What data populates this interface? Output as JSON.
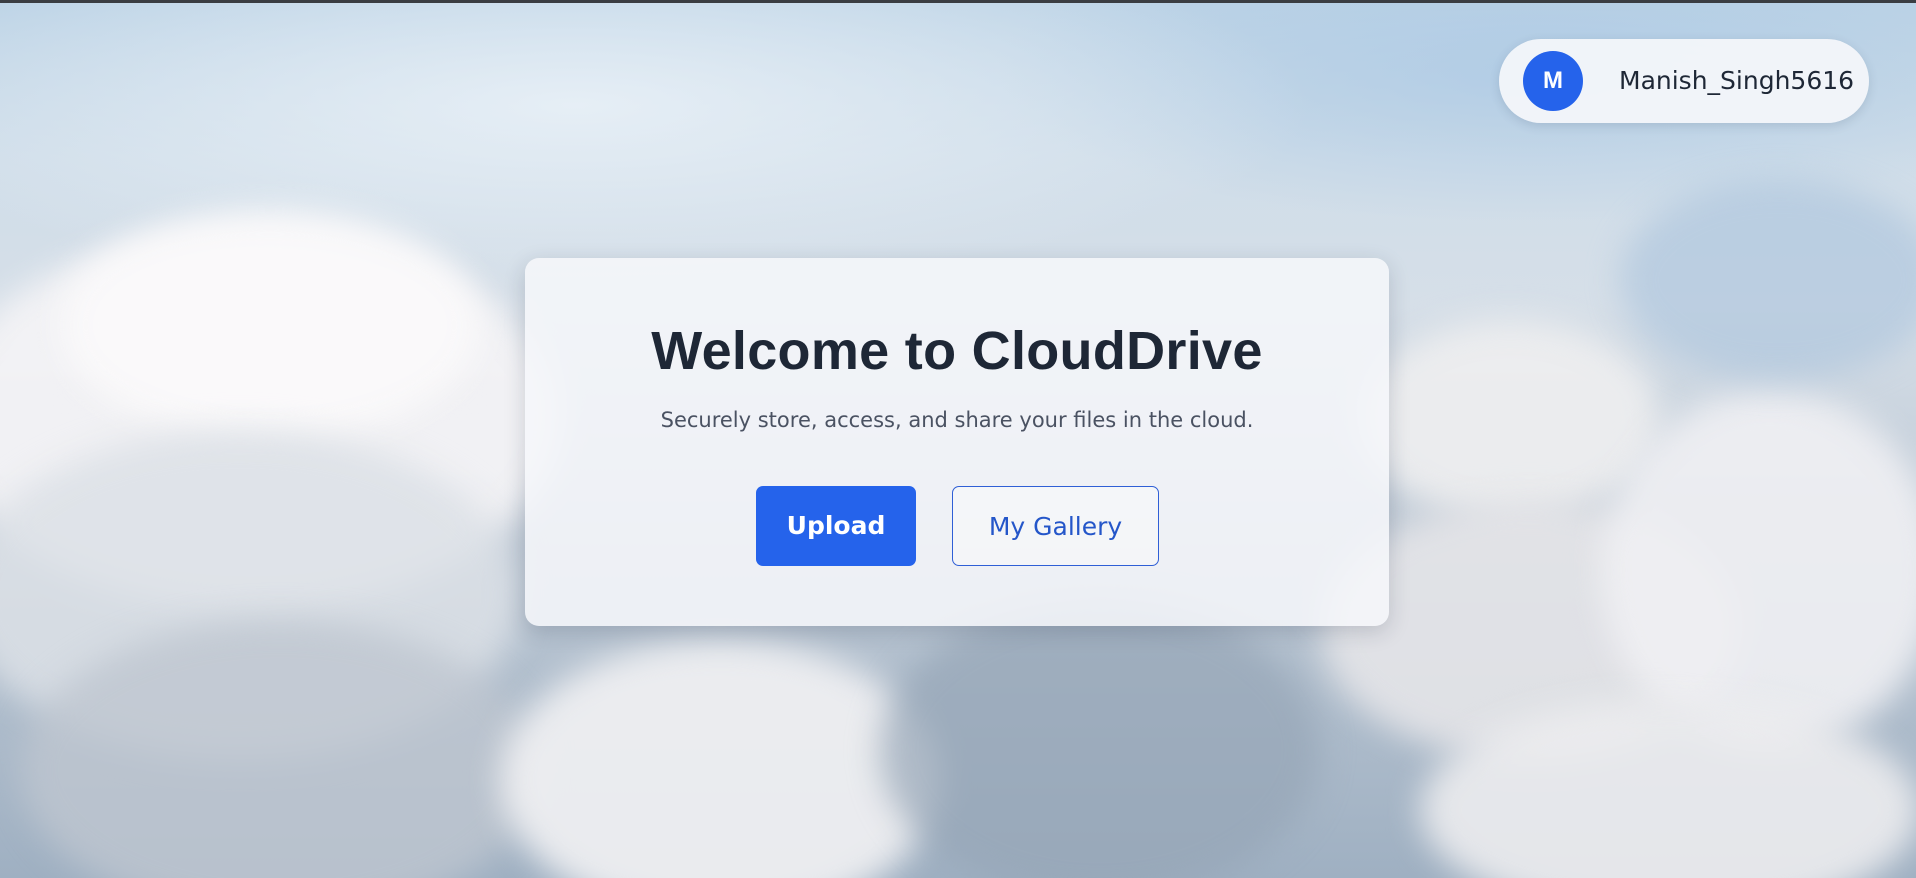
{
  "user": {
    "avatar_initial": "M",
    "username": "Manish_Singh5616"
  },
  "hero": {
    "title": "Welcome to CloudDrive",
    "subtitle": "Securely store, access, and share your files in the cloud.",
    "upload_label": "Upload",
    "gallery_label": "My Gallery"
  },
  "colors": {
    "accent": "#2563eb",
    "title_text": "#1e2736"
  }
}
